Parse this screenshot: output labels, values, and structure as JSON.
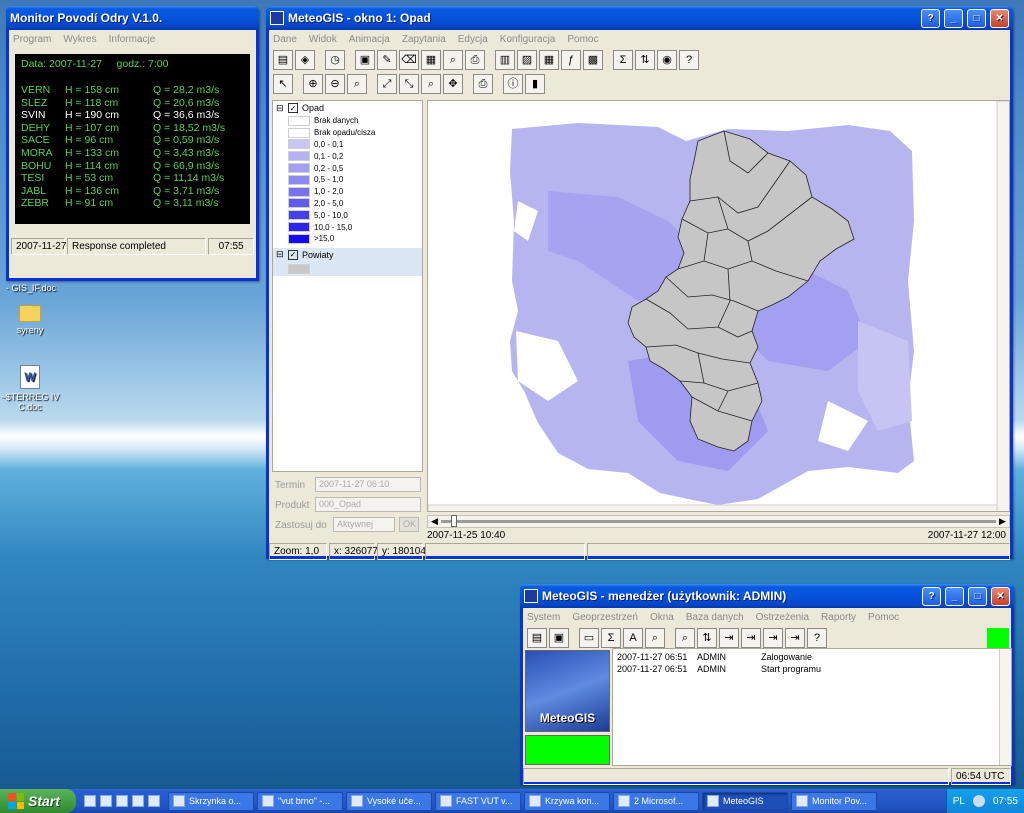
{
  "desktop": {
    "doc_label": "- GIS_IF.doc",
    "icons": [
      {
        "label": "syreny"
      },
      {
        "label": "~$TERREG IV C.doc"
      }
    ]
  },
  "monitor": {
    "title": "Monitor Povodí Odry V.1.0.",
    "menu": [
      "Program",
      "Wykres",
      "Informacje"
    ],
    "header": "Data: 2007-11-27     godz.: 7:00",
    "rows": [
      {
        "station": "VERN",
        "h": "H = 158 cm",
        "q": "Q = 28,2 m3/s",
        "highlight": false
      },
      {
        "station": "SLEZ",
        "h": "H = 118 cm",
        "q": "Q = 20,6 m3/s",
        "highlight": false
      },
      {
        "station": "SVIN",
        "h": "H = 190 cm",
        "q": "Q = 36,6 m3/s",
        "highlight": true
      },
      {
        "station": "DEHY",
        "h": "H = 107 cm",
        "q": "Q = 18,52 m3/s",
        "highlight": false
      },
      {
        "station": "SACE",
        "h": "H = 96 cm",
        "q": "Q = 0,59 m3/s",
        "highlight": false
      },
      {
        "station": "MORA",
        "h": "H = 133 cm",
        "q": "Q = 3,43 m3/s",
        "highlight": false
      },
      {
        "station": "BOHU",
        "h": "H = 114 cm",
        "q": "Q = 66,9 m3/s",
        "highlight": false
      },
      {
        "station": "TESI",
        "h": "H = 53 cm",
        "q": "Q = 11,14 m3/s",
        "highlight": false
      },
      {
        "station": "JABL",
        "h": "H = 136 cm",
        "q": "Q = 3,71 m3/s",
        "highlight": false
      },
      {
        "station": "ZEBR",
        "h": "H = 91 cm",
        "q": "Q = 3,11 m3/s",
        "highlight": false
      }
    ],
    "status": {
      "date": "2007-11-27",
      "message": "Response completed",
      "time": "07:55"
    }
  },
  "meteogis": {
    "title": "MeteoGIS - okno 1: Opad",
    "menu": [
      "Dane",
      "Widok",
      "Animacja",
      "Zapytania",
      "Edycja",
      "Konfiguracja",
      "Pomoc"
    ],
    "toolbar1": [
      "folder-open-icon",
      "layers-icon",
      "clock-icon",
      "save-icon",
      "edit-layer-icon",
      "erase-icon",
      "export-image-icon",
      "print-preview-icon",
      "print-icon",
      "table-icon",
      "chart-icon",
      "grid-icon",
      "formula-icon",
      "calendar-grid-icon",
      "sum-icon",
      "sort-icon",
      "eye-icon",
      "help-icon"
    ],
    "toolbar2": [
      "pointer-icon",
      "zoom-in-icon",
      "zoom-out-icon",
      "zoom-icon",
      "full-extent-icon",
      "fit-icon",
      "magnify-icon",
      "pan-icon",
      "print-icon",
      "info-icon",
      "bar-chart-icon"
    ],
    "legend": {
      "layer_opad": "Opad",
      "classes": [
        {
          "label": "Brak danych",
          "color": "#ffffff"
        },
        {
          "label": "Brak opadu/cisza",
          "color": "#ffffff"
        },
        {
          "label": "0,0 - 0,1",
          "color": "#c9c6f3"
        },
        {
          "label": "0,1 - 0,2",
          "color": "#b6b2f2"
        },
        {
          "label": "0,2 - 0,5",
          "color": "#a39ff1"
        },
        {
          "label": "0,5 - 1,0",
          "color": "#8e89f0"
        },
        {
          "label": "1,0 - 2,0",
          "color": "#7872ef"
        },
        {
          "label": "2,0 - 5,0",
          "color": "#615aee"
        },
        {
          "label": "5,0 - 10,0",
          "color": "#4840ed"
        },
        {
          "label": "10,0 - 15,0",
          "color": "#2e25ec"
        },
        {
          "label": ">15,0",
          "color": "#150bf0"
        }
      ],
      "layer_powiaty": "Powiaty",
      "powiaty_color": "#c8c8c8"
    },
    "controls": {
      "termin_label": "Termin",
      "termin_value": "2007-11-27 06:10",
      "produkt_label": "Produkt",
      "produkt_value": "000_Opad",
      "zastosuj_label": "Zastosuj do",
      "zastosuj_value": "Aktywnej",
      "ok_label": "OK"
    },
    "timeline": {
      "start": "2007-11-25 10:40",
      "end": "2007-11-27 12:00"
    },
    "status": {
      "zoom": "Zoom: 1,0",
      "x": "x: 326077",
      "y": "y: 180104"
    }
  },
  "manager": {
    "title": "MeteoGIS - menedżer (użytkownik: ADMIN)",
    "menu": [
      "System",
      "Geoprzestrzeń",
      "Okna",
      "Baza danych",
      "Ostrzeżenia",
      "Raporty",
      "Pomoc"
    ],
    "logo_text": "MeteoGIS",
    "log": [
      {
        "time": "2007-11-27 06:51",
        "user": "ADMIN",
        "event": "Zalogowanie"
      },
      {
        "time": "2007-11-27 06:51",
        "user": "ADMIN",
        "event": "Start programu"
      }
    ],
    "status_time": "06:54  UTC",
    "status_color": "#00ff00"
  },
  "taskbar": {
    "start_label": "Start",
    "tasks": [
      {
        "label": "Skrzynka o...",
        "active": false
      },
      {
        "label": "\"vut brno\" -...",
        "active": false
      },
      {
        "label": "Vysoké uče...",
        "active": false
      },
      {
        "label": "FAST VUT v...",
        "active": false
      },
      {
        "label": "Krzywa kon...",
        "active": false
      },
      {
        "label": "2 Microsof...",
        "active": false
      },
      {
        "label": "MeteoGIS",
        "active": true
      },
      {
        "label": "Monitor Pov...",
        "active": false
      }
    ],
    "lang": "PL",
    "clock": "07:55"
  }
}
